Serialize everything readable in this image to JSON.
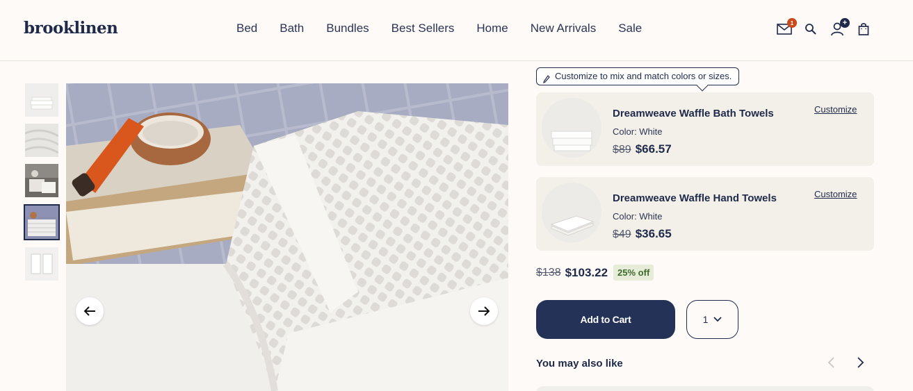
{
  "header": {
    "logo": "brooklinen",
    "nav": [
      "Bed",
      "Bath",
      "Bundles",
      "Best Sellers",
      "Home",
      "New Arrivals",
      "Sale"
    ],
    "mail_badge": "1",
    "account_badge": "+"
  },
  "tooltip": "Customize to mix and match colors or sizes.",
  "items": [
    {
      "name": "Dreamweave Waffle Bath Towels",
      "color": "Color: White",
      "old_price": "$89",
      "price": "$66.57",
      "customize": "Customize"
    },
    {
      "name": "Dreamweave Waffle Hand Towels",
      "color": "Color: White",
      "old_price": "$49",
      "price": "$36.65",
      "customize": "Customize"
    }
  ],
  "totals": {
    "old": "$138",
    "new": "$103.22",
    "discount": "25% off"
  },
  "cart": {
    "label": "Add to Cart",
    "qty": "1"
  },
  "also_like": "You may also like",
  "colors": {
    "navy": "#1f2a4a",
    "button": "#243257",
    "badge_orange": "#c94a1c",
    "bg": "#fdfaf7"
  }
}
